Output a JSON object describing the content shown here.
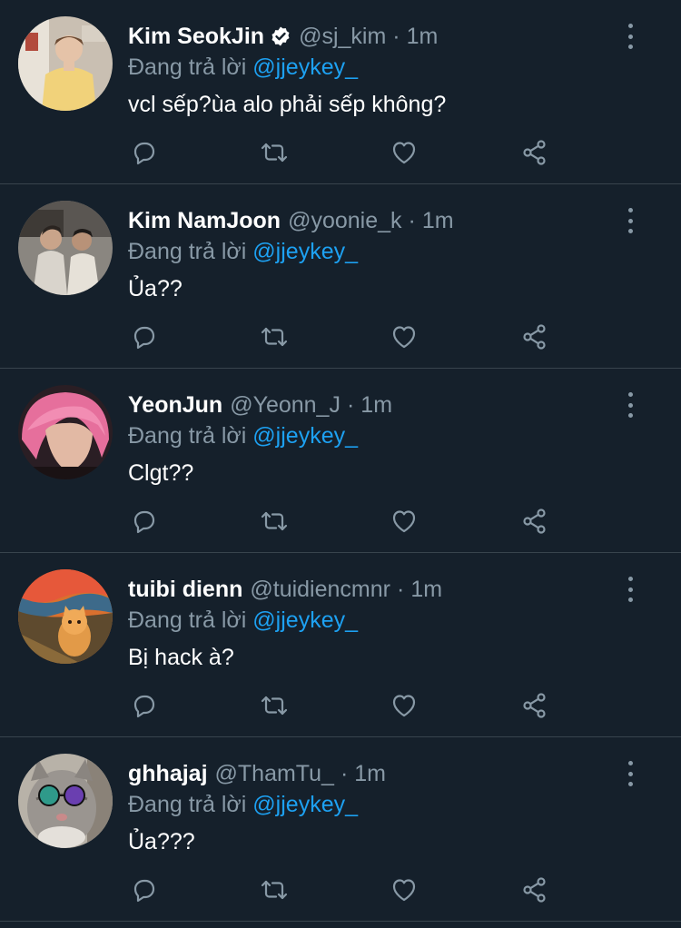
{
  "replying_to_label": "Đang trả lời",
  "replies": [
    {
      "name": "Kim SeokJin",
      "verified": true,
      "handle": "@sj_kim",
      "separator": "·",
      "time": "1m",
      "replying_to": "@jjeykey_",
      "text": "vcl sếp?ùa alo phải sếp không?",
      "avatar": "avatar-photo-person-yellow-shirt"
    },
    {
      "name": "Kim NamJoon",
      "verified": false,
      "handle": "@yoonie_k",
      "separator": "·",
      "time": "1m",
      "replying_to": "@jjeykey_",
      "text": "Ủa??",
      "avatar": "avatar-photo-two-people"
    },
    {
      "name": "YeonJun",
      "verified": false,
      "handle": "@Yeonn_J",
      "separator": "·",
      "time": "1m",
      "replying_to": "@jjeykey_",
      "text": "Clgt??",
      "avatar": "avatar-photo-pink-hair"
    },
    {
      "name": "tuibi dienn",
      "verified": false,
      "handle": "@tuidiencmnr",
      "separator": "·",
      "time": "1m",
      "replying_to": "@jjeykey_",
      "text": "Bị hack à?",
      "avatar": "avatar-scream-painting-cat"
    },
    {
      "name": "ghhajaj",
      "verified": false,
      "handle": "@ThamTu_",
      "separator": "·",
      "time": "1m",
      "replying_to": "@jjeykey_",
      "text": "Ủa???",
      "avatar": "avatar-cat-sunglasses"
    }
  ],
  "icons": {
    "reply": "reply-icon",
    "retweet": "retweet-icon",
    "like": "heart-icon",
    "share": "share-icon",
    "more": "more-vertical-icon",
    "verified": "verified-badge-icon"
  },
  "colors": {
    "background": "#15202b",
    "divider": "#38444d",
    "secondary_text": "#8899a6",
    "link": "#1da1f2",
    "primary_text": "#ffffff"
  }
}
